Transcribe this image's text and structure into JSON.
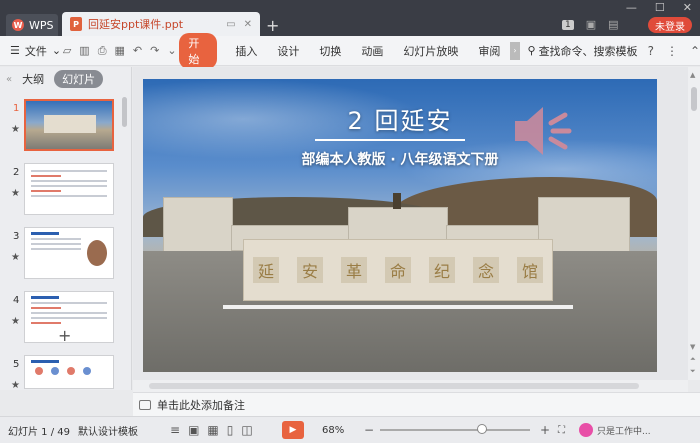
{
  "titlebar": {
    "app_tab": "WPS",
    "doc_tab": "回延安ppt课件.ppt",
    "new_tab": "+",
    "page_badge": "1",
    "login": "未登录"
  },
  "toolbar": {
    "file": "文件",
    "start": "开始",
    "tabs": [
      "插入",
      "设计",
      "切换",
      "动画",
      "幻灯片放映",
      "审阅"
    ],
    "search": "查找命令、搜索模板",
    "help": "?"
  },
  "left_panel": {
    "tab_outline": "大纲",
    "tab_slides": "幻灯片",
    "slide_numbers": [
      "1",
      "2",
      "3",
      "4",
      "5"
    ],
    "star": "★",
    "add": "+"
  },
  "slide": {
    "title": "2 回延安",
    "subtitle": "部编本人教版 · 八年级语文下册",
    "monument_chars": [
      "延",
      "安",
      "革",
      "命",
      "纪",
      "念",
      "馆"
    ]
  },
  "notes": {
    "placeholder": "单击此处添加备注"
  },
  "statusbar": {
    "slide_info": "幻灯片 1 / 49",
    "template": "默认设计模板",
    "zoom": "68%",
    "zoom_level": 0.68,
    "minus": "−",
    "plus": "+",
    "status": "只是工作中..."
  },
  "colors": {
    "accent": "#e8633f",
    "login": "#e04b3a",
    "titlebar": "#3a3d45"
  }
}
